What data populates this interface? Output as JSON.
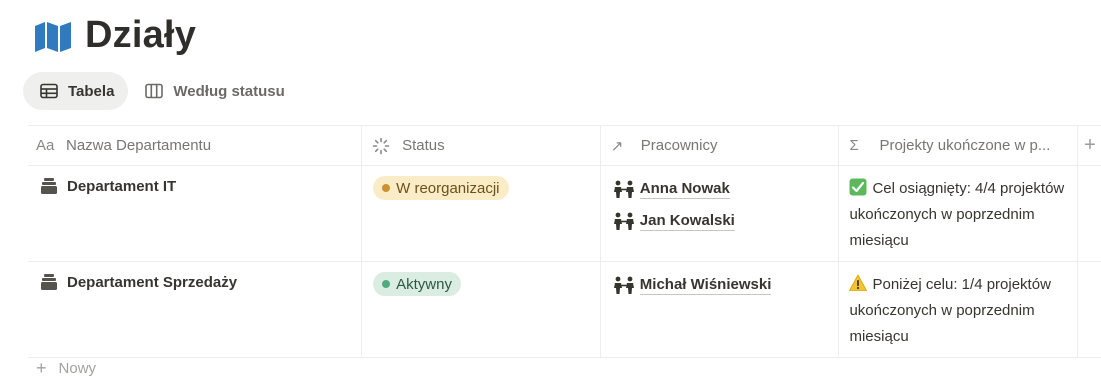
{
  "page": {
    "icon": "map-icon",
    "title": "Działy"
  },
  "views": [
    {
      "label": "Tabela",
      "icon": "table-icon",
      "active": true
    },
    {
      "label": "Według statusu",
      "icon": "board-icon",
      "active": false
    }
  ],
  "table": {
    "columns": [
      {
        "label": "Nazwa Departamentu",
        "icon": "text-type-icon",
        "glyph": "Aa"
      },
      {
        "label": "Status",
        "icon": "status-spinner-icon",
        "glyph": ""
      },
      {
        "label": "Pracownicy",
        "icon": "relation-arrow-icon",
        "glyph": "↗"
      },
      {
        "label": "Projekty ukończone w p...",
        "icon": "sigma-icon",
        "glyph": "Σ"
      }
    ],
    "add_column_label": "+",
    "rows": [
      {
        "name": "Departament IT",
        "name_icon": "archive-icon",
        "status": {
          "label": "W reorganizacji",
          "dot_color": "#cb912f",
          "bg": "#fbecc8",
          "text_color": "#6b5018"
        },
        "people": [
          "Anna Nowak",
          "Jan Kowalski"
        ],
        "summary_icon": "check-mark-button-icon",
        "summary": "Cel osiągnięty: 4/4 projektów ukończonych w poprzednim miesiącu"
      },
      {
        "name": "Departament Sprzedaży",
        "name_icon": "archive-icon",
        "status": {
          "label": "Aktywny",
          "dot_color": "#4dab7c",
          "bg": "#dbede3",
          "text_color": "#2b5a41"
        },
        "people": [
          "Michał Wiśniewski"
        ],
        "summary_icon": "warning-icon",
        "summary": "Poniżej celu: 1/4 projektów ukończonych w poprzednim miesiącu"
      }
    ],
    "new_row_label": "Nowy"
  },
  "colors": {
    "map_icon": "#2e7bbf",
    "grid_line": "#ededeb",
    "header_text": "#787672"
  }
}
